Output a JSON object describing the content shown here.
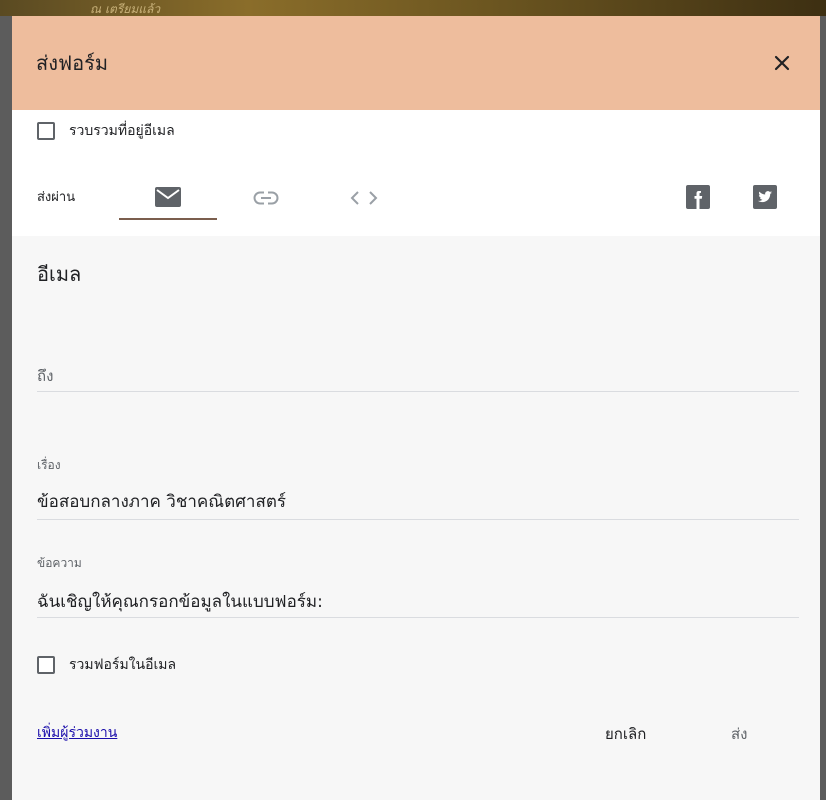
{
  "background": {
    "partial_text": "ณ เตรียมแล้ว"
  },
  "dialog": {
    "title": "ส่งฟอร์ม",
    "collect_email_label": "รวบรวมที่อยู่อีเมล",
    "send_via_label": "ส่งผ่าน",
    "tabs": [
      {
        "icon": "email-icon",
        "active": true
      },
      {
        "icon": "link-icon",
        "active": false
      },
      {
        "icon": "embed-code-icon",
        "active": false
      }
    ],
    "social": [
      "facebook-icon",
      "twitter-icon"
    ],
    "section_title": "อีเมล",
    "to": {
      "placeholder": "ถึง",
      "value": ""
    },
    "subject": {
      "label": "เรื่อง",
      "value": "ข้อสอบกลางภาค วิชาคณิตศาสตร์"
    },
    "message": {
      "label": "ข้อความ",
      "value": "ฉันเชิญให้คุณกรอกข้อมูลในแบบฟอร์ม:"
    },
    "include_form_label": "รวมฟอร์มในอีเมล",
    "add_collaborators": "เพิ่มผู้ร่วมงาน",
    "cancel_label": "ยกเลิก",
    "send_label": "ส่ง"
  },
  "colors": {
    "header_bg": "#eebd9d",
    "tab_underline": "#7b5e4d",
    "link": "#1a0dab"
  }
}
